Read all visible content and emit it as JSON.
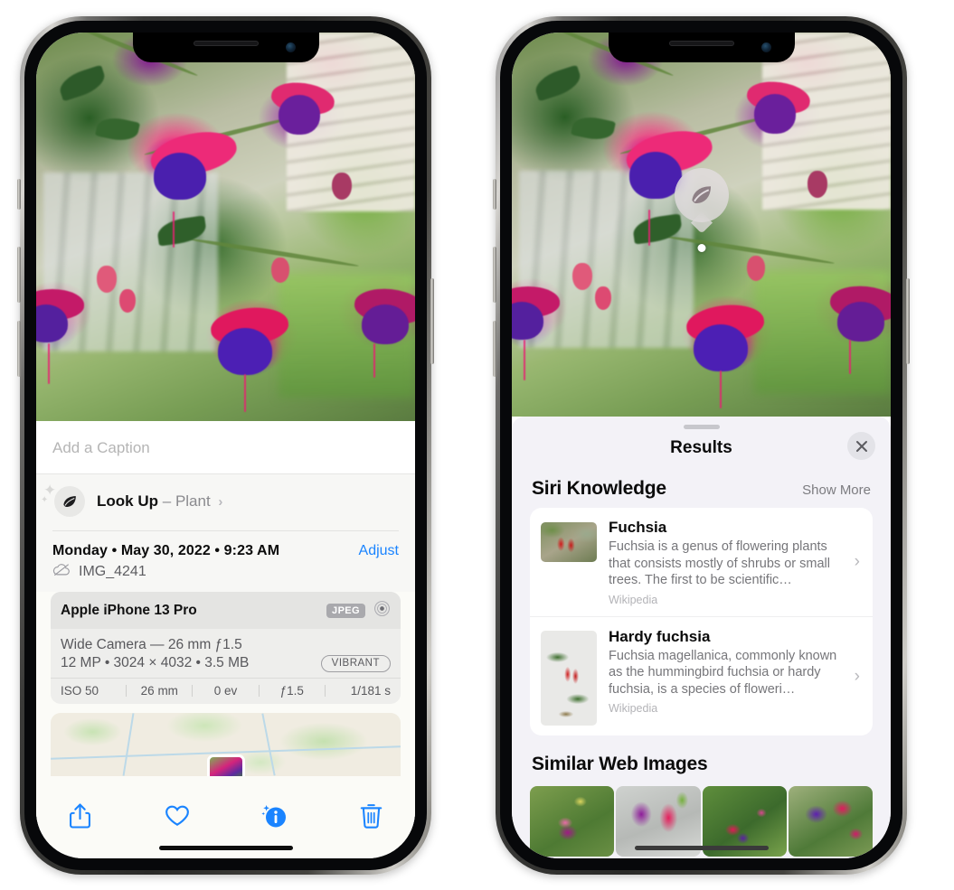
{
  "left_phone": {
    "name": "photos-detail-phone",
    "photo_alt": "fuchsia-flowers-photo",
    "caption_placeholder": "Add a Caption",
    "lookup": {
      "icon": "leaf-icon",
      "sparkle_icon": "sparkles-icon",
      "label": "Look Up",
      "dash": "–",
      "subject": "Plant",
      "chevron": "›"
    },
    "metadata": {
      "date_line": "Monday • May 30, 2022 • 9:23 AM",
      "adjust_label": "Adjust",
      "cloud_icon": "icloud-slash-icon",
      "filename": "IMG_4241"
    },
    "exif": {
      "device": "Apple iPhone 13 Pro",
      "format_badge": "JPEG",
      "raw_icon": "aperture-icon",
      "lens_line": "Wide Camera — 26 mm ƒ1.5",
      "size_line": "12 MP • 3024 × 4032 • 3.5 MB",
      "style_badge": "VIBRANT",
      "stats": [
        "ISO 50",
        "26 mm",
        "0 ev",
        "ƒ1.5",
        "1/181 s"
      ]
    },
    "map": {
      "name": "location-map-thumbnail",
      "pin": "photo-pin"
    },
    "toolbar": [
      {
        "icon": "share-icon",
        "name": "share-button"
      },
      {
        "icon": "heart-icon",
        "name": "favorite-button"
      },
      {
        "icon": "info-sparkle-icon",
        "name": "info-button"
      },
      {
        "icon": "trash-icon",
        "name": "delete-button"
      }
    ]
  },
  "right_phone": {
    "name": "visual-lookup-results-phone",
    "visual_badge": {
      "icon": "leaf-icon",
      "name": "visual-lookup-badge"
    },
    "sheet": {
      "title": "Results",
      "close_icon": "close-icon",
      "sections": [
        {
          "title": "Siri Knowledge",
          "action": "Show More",
          "items": [
            {
              "title": "Fuchsia",
              "description": "Fuchsia is a genus of flowering plants that consists mostly of shrubs or small trees. The first to be scientific…",
              "source": "Wikipedia",
              "thumb": "fuchsia-red-flowers-thumb",
              "chevron": "›"
            },
            {
              "title": "Hardy fuchsia",
              "description": "Fuchsia magellanica, commonly known as the hummingbird fuchsia or hardy fuchsia, is a species of floweri…",
              "source": "Wikipedia",
              "thumb": "hardy-fuchsia-specimen-thumb",
              "chevron": "›"
            }
          ]
        },
        {
          "title": "Similar Web Images",
          "images": [
            {
              "name": "similar-image-1"
            },
            {
              "name": "similar-image-2"
            },
            {
              "name": "similar-image-3"
            },
            {
              "name": "similar-image-4"
            }
          ]
        }
      ]
    }
  },
  "colors": {
    "accent_blue": "#1a84ff",
    "sheet_bg": "#f3f2f7",
    "panel_bg": "#fbfbf7",
    "card_bg": "#ffffff",
    "secondary_text": "#8a8a8e"
  }
}
